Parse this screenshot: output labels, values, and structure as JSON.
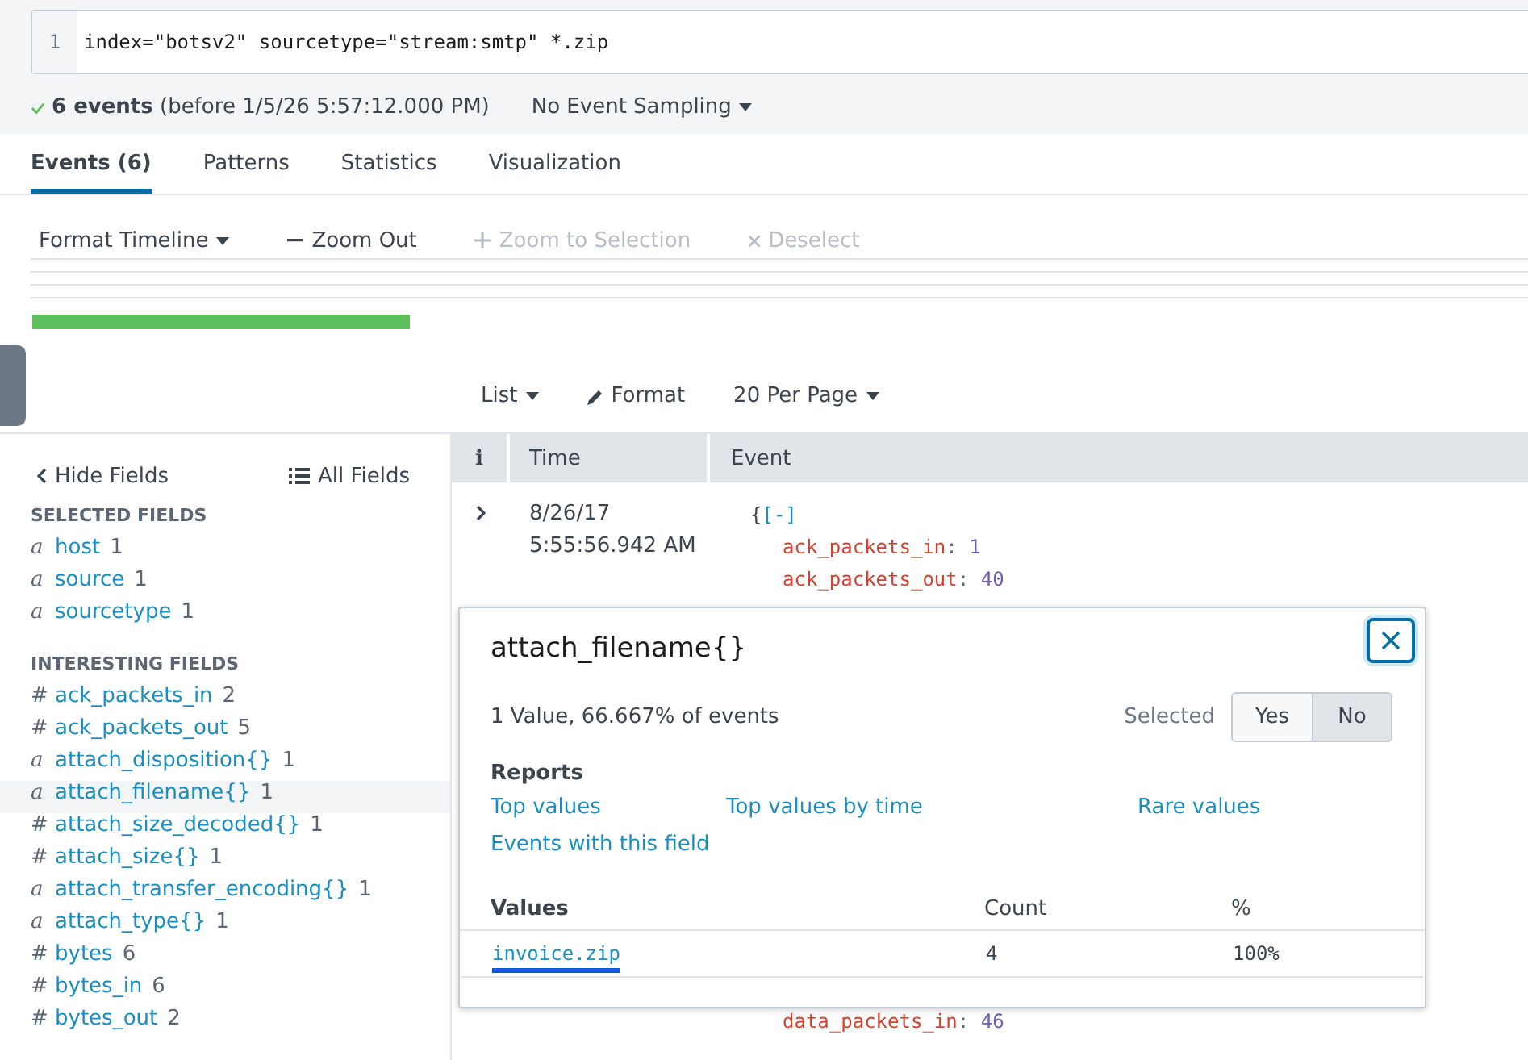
{
  "search": {
    "line_number": "1",
    "query": "index=\"botsv2\" sourcetype=\"stream:smtp\" *.zip"
  },
  "status": {
    "count": "6 events",
    "detail": "(before 1/5/26 5:57:12.000 PM)",
    "sampling": "No Event Sampling"
  },
  "tabs": [
    {
      "label": "Events (6)",
      "selected": true
    },
    {
      "label": "Patterns",
      "selected": false
    },
    {
      "label": "Statistics",
      "selected": false
    },
    {
      "label": "Visualization",
      "selected": false
    }
  ],
  "timeline_toolbar": [
    {
      "label": "Format Timeline",
      "kind": "dropdown",
      "disabled": false
    },
    {
      "label": "Zoom Out",
      "kind": "shrink",
      "disabled": false
    },
    {
      "label": "Zoom to Selection",
      "kind": "grow",
      "disabled": true
    },
    {
      "label": "Deselect",
      "kind": "clear",
      "disabled": true
    }
  ],
  "results_toolbar": [
    {
      "label": "List",
      "kind": "dropdown"
    },
    {
      "label": "Format",
      "kind": "edit"
    },
    {
      "label": "20 Per Page",
      "kind": "dropdown"
    }
  ],
  "sidebar": {
    "hide": "Hide Fields",
    "all": "All Fields",
    "groups": [
      {
        "title": "SELECTED FIELDS",
        "fields": [
          {
            "kind": "string",
            "type": "a",
            "name": "host",
            "count": "1",
            "selected": false
          },
          {
            "kind": "string",
            "type": "a",
            "name": "source",
            "count": "1",
            "selected": false
          },
          {
            "kind": "string",
            "type": "a",
            "name": "sourcetype",
            "count": "1",
            "selected": false
          }
        ]
      },
      {
        "title": "INTERESTING FIELDS",
        "fields": [
          {
            "kind": "number",
            "type": "#",
            "name": "ack_packets_in",
            "count": "2",
            "selected": false
          },
          {
            "kind": "number",
            "type": "#",
            "name": "ack_packets_out",
            "count": "5",
            "selected": false
          },
          {
            "kind": "string",
            "type": "a",
            "name": "attach_disposition{}",
            "count": "1",
            "selected": false
          },
          {
            "kind": "string",
            "type": "a",
            "name": "attach_filename{}",
            "count": "1",
            "selected": true
          },
          {
            "kind": "number",
            "type": "#",
            "name": "attach_size_decoded{}",
            "count": "1",
            "selected": false
          },
          {
            "kind": "number",
            "type": "#",
            "name": "attach_size{}",
            "count": "1",
            "selected": false
          },
          {
            "kind": "string",
            "type": "a",
            "name": "attach_transfer_encoding{}",
            "count": "1",
            "selected": false
          },
          {
            "kind": "string",
            "type": "a",
            "name": "attach_type{}",
            "count": "1",
            "selected": false
          },
          {
            "kind": "number",
            "type": "#",
            "name": "bytes",
            "count": "6",
            "selected": false
          },
          {
            "kind": "number",
            "type": "#",
            "name": "bytes_in",
            "count": "6",
            "selected": false
          },
          {
            "kind": "number",
            "type": "#",
            "name": "bytes_out",
            "count": "2",
            "selected": false
          }
        ]
      }
    ]
  },
  "table": {
    "columns": [
      "i",
      "Time",
      "Event"
    ],
    "rows": [
      {
        "time": [
          "8/26/17",
          "5:55:56.942 AM"
        ],
        "open": "{",
        "toggle": "[-]",
        "fields": [
          {
            "key": "ack_packets_in",
            "sep": ":",
            "value": "1"
          },
          {
            "key": "ack_packets_out",
            "sep": ":",
            "value": "40"
          }
        ],
        "later_fields": [
          {
            "key": "data_packets_in",
            "sep": ":",
            "value": "46"
          }
        ]
      }
    ]
  },
  "popup": {
    "title": "attach_filename{}",
    "summary": "1 Value, 66.667% of events",
    "selected_label": "Selected",
    "options": [
      {
        "label": "Yes",
        "selected": false
      },
      {
        "label": "No",
        "selected": true
      }
    ],
    "reports_title": "Reports",
    "reports": [
      "Top values",
      "Top values by time",
      "Rare values",
      "Events with this field"
    ],
    "columns": [
      "Values",
      "Count",
      "%"
    ],
    "rows": [
      {
        "value": "invoice.zip",
        "count": "4",
        "percent": "100%"
      }
    ]
  }
}
